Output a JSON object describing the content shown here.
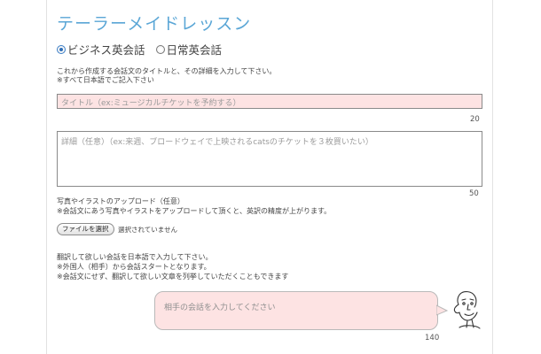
{
  "page": {
    "title": "テーラーメイドレッスン"
  },
  "lesson_type": {
    "options": [
      {
        "label": "ビジネス英会話",
        "selected": true
      },
      {
        "label": "日常英会話",
        "selected": false
      }
    ]
  },
  "instructions": {
    "line1": "これから作成する会話文のタイトルと、その詳細を入力して下さい。",
    "line2": "※すべて日本語でご記入下さい"
  },
  "title_field": {
    "placeholder": "タイトル（ex:ミュージカルチケットを予約する）",
    "max_chars": "20"
  },
  "detail_field": {
    "placeholder": "詳細（任意）（ex:来週、ブロードウェイで上映されるcatsのチケットを３枚買いたい）",
    "max_chars": "50"
  },
  "upload": {
    "line1": "写真やイラストのアップロード（任意）",
    "line2": "※会話文にあう写真やイラストをアップロードして頂くと、英訳の精度が上がります。",
    "button_label": "ファイルを選択",
    "status": "選択されていません"
  },
  "translation_notes": {
    "line1": "翻訳して欲しい会話を日本語で入力して下さい。",
    "line2": "※外国人（相手）から会話スタートとなります。",
    "line3": "※会話文にせず、翻訳して欲しい文章を列挙していただくこともできます"
  },
  "partner_bubble": {
    "placeholder": "相手の会話を入力してください",
    "max_chars": "140"
  },
  "icons": {
    "avatar": "partner-face-sketch-icon"
  },
  "colors": {
    "title_blue": "#5aa6d6",
    "input_pink": "#fde3e3"
  }
}
